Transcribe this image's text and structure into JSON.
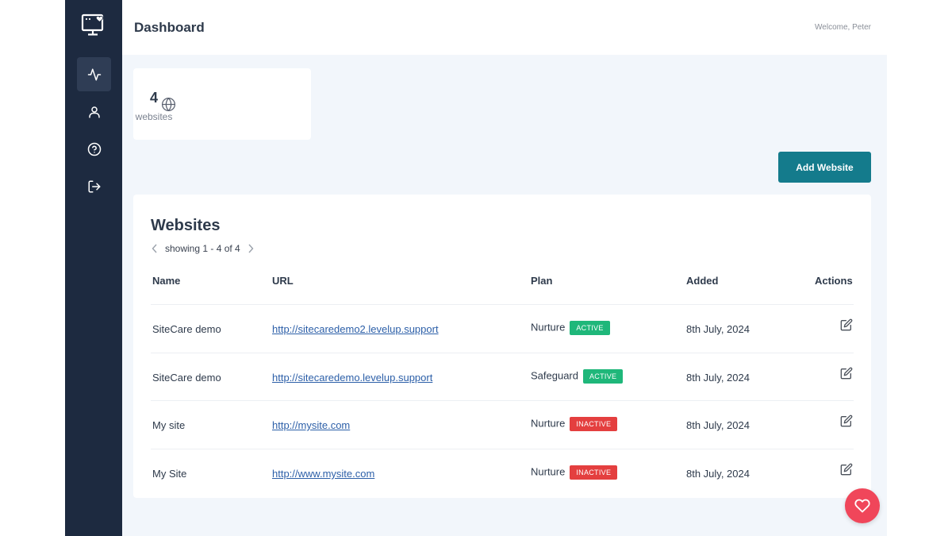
{
  "app": {
    "sidebar": {
      "items": [
        {
          "icon": "activity-icon",
          "active": true
        },
        {
          "icon": "user-icon",
          "active": false
        },
        {
          "icon": "help-icon",
          "active": false
        },
        {
          "icon": "logout-icon",
          "active": false
        }
      ]
    },
    "header": {
      "title": "Dashboard",
      "welcome": "Welcome, Peter"
    },
    "stat": {
      "value": "4",
      "label": "websites",
      "icon": "globe-icon"
    },
    "add_button_label": "Add Website",
    "websites": {
      "title": "Websites",
      "pager_text": "showing 1 - 4 of 4",
      "columns": [
        "Name",
        "URL",
        "Plan",
        "Added",
        "Actions"
      ],
      "rows": [
        {
          "name": "SiteCare demo",
          "url": "http://sitecaredemo2.levelup.support",
          "plan": "Nurture",
          "status": "ACTIVE",
          "added": "8th July, 2024"
        },
        {
          "name": "SiteCare demo",
          "url": "http://sitecaredemo.levelup.support",
          "plan": "Safeguard",
          "status": "ACTIVE",
          "added": "8th July, 2024"
        },
        {
          "name": "My site",
          "url": "http://mysite.com",
          "plan": "Nurture",
          "status": "INACTIVE",
          "added": "8th July, 2024"
        },
        {
          "name": "My Site",
          "url": "http://www.mysite.com",
          "plan": "Nurture",
          "status": "INACTIVE",
          "added": "8th July, 2024"
        }
      ]
    },
    "colors": {
      "sidebar": "#1d2a40",
      "accent": "#147b8c",
      "active": "#1fb77a",
      "inactive": "#e43f3f",
      "fab": "#f0465a",
      "link": "#2c5fa8"
    }
  }
}
